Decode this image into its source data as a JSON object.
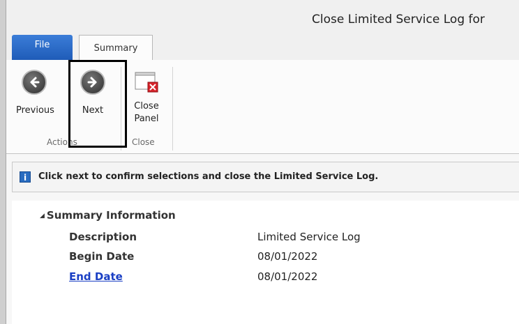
{
  "window": {
    "title": "Close Limited Service Log for"
  },
  "tabs": {
    "file": "File",
    "summary": "Summary"
  },
  "ribbon": {
    "previous": "Previous",
    "next": "Next",
    "close_panel_line1": "Close",
    "close_panel_line2": "Panel",
    "group_actions": "Actions",
    "group_close": "Close"
  },
  "info": {
    "message": "Click next to confirm selections and close the Limited Service Log."
  },
  "summary": {
    "heading": "Summary Information",
    "rows": [
      {
        "label": "Description",
        "value": "Limited Service Log"
      },
      {
        "label": "Begin Date",
        "value": "08/01/2022"
      },
      {
        "label": "End Date",
        "value": "08/01/2022"
      }
    ]
  },
  "colors": {
    "file_tab": "#1f5cb8",
    "link": "#1a3fc4",
    "info_icon": "#2a6cc0"
  },
  "icons": [
    "arrow-left-icon",
    "arrow-right-icon",
    "close-panel-icon",
    "info-icon",
    "collapse-triangle-icon"
  ]
}
